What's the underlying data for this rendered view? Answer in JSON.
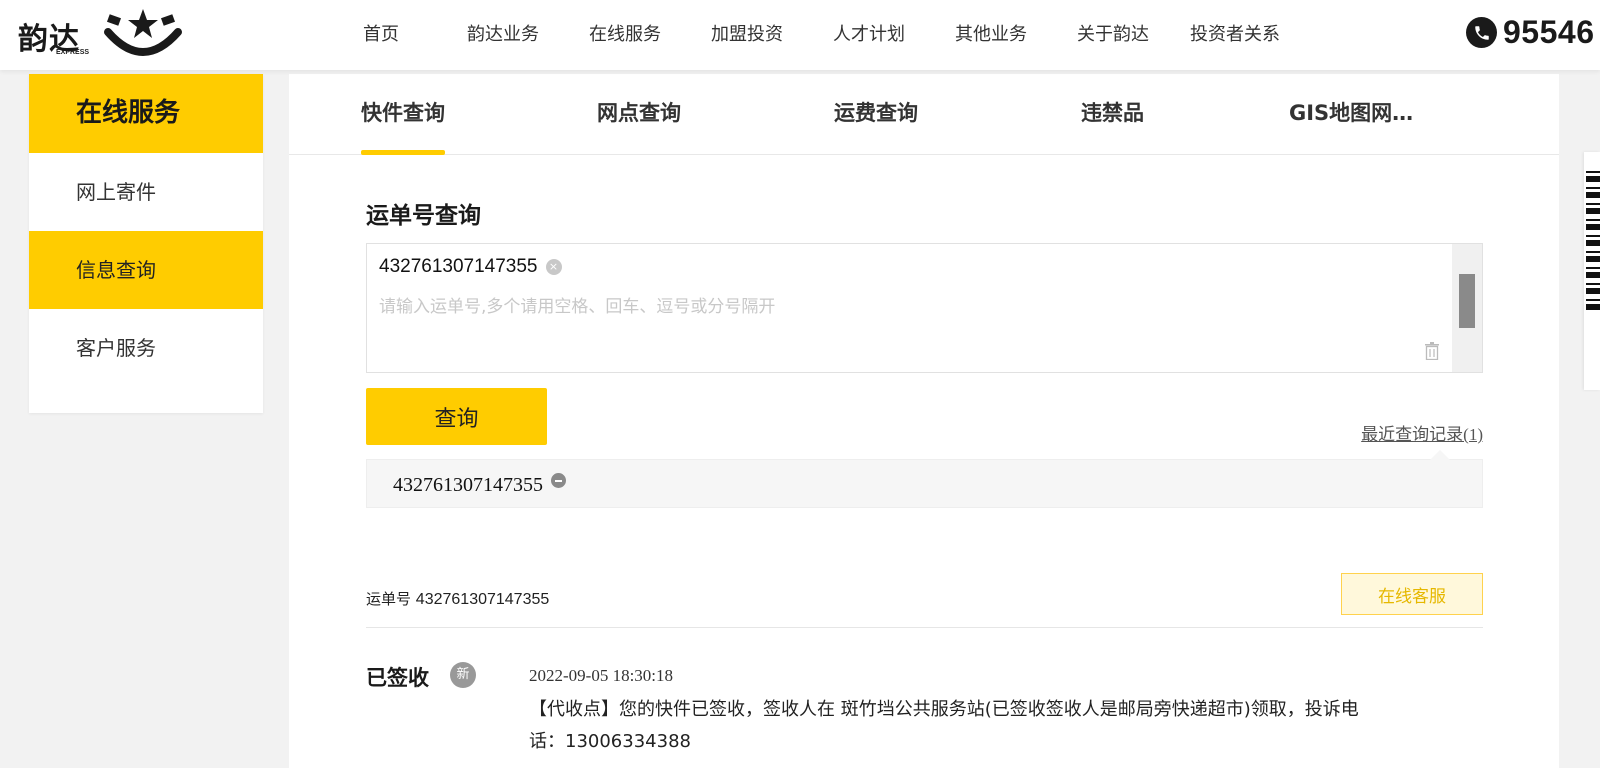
{
  "header": {
    "logo_text": "韵达",
    "logo_sub": "EXPRESS",
    "nav": [
      "首页",
      "韵达业务",
      "在线服务",
      "加盟投资",
      "人才计划",
      "其他业务",
      "关于韵达",
      "投资者关系"
    ],
    "hotline": "95546"
  },
  "sidebar": {
    "title": "在线服务",
    "items": [
      {
        "label": "网上寄件",
        "active": false
      },
      {
        "label": "信息查询",
        "active": true
      },
      {
        "label": "客户服务",
        "active": false
      }
    ]
  },
  "tabs": [
    {
      "label": "快件查询",
      "active": true
    },
    {
      "label": "网点查询",
      "active": false
    },
    {
      "label": "运费查询",
      "active": false
    },
    {
      "label": "违禁品",
      "active": false
    },
    {
      "label": "GIS地图网…",
      "active": false
    }
  ],
  "query": {
    "section_title": "运单号查询",
    "tag_value": "432761307147355",
    "tag_remove": "×",
    "placeholder": "请输入运单号,多个请用空格、回车、逗号或分号隔开",
    "button_label": "查询",
    "recent_link": "最近查询记录(1)",
    "history": [
      "432761307147355"
    ]
  },
  "result": {
    "waybill_label": "运单号",
    "waybill_number": "432761307147355",
    "service_button": "在线客服",
    "status": "已签收",
    "new_badge": "新",
    "event_time": "2022-09-05 18:30:18",
    "event_desc": "【代收点】您的快件已签收，签收人在 斑竹垱公共服务站(已签收签收人是邮局旁快递超市)领取，投诉电话：13006334388"
  },
  "colors": {
    "accent": "#ffcc00",
    "service_btn_bg": "#fff8db",
    "service_btn_text": "#e6b800"
  }
}
